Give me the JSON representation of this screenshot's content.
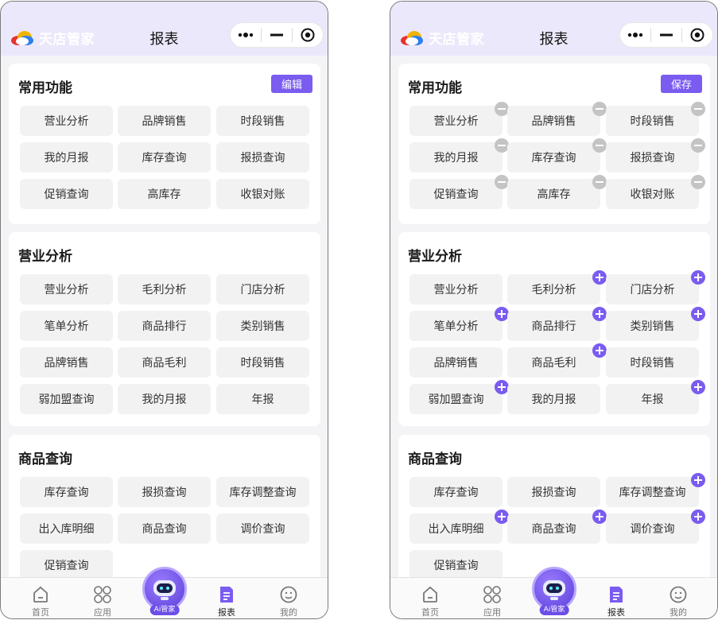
{
  "screens": [
    {
      "id": "view",
      "app_name": "天店管家",
      "page_title": "报表",
      "sections": [
        {
          "title": "常用功能",
          "action": "编辑",
          "items": [
            {
              "label": "营业分析"
            },
            {
              "label": "品牌销售"
            },
            {
              "label": "时段销售"
            },
            {
              "label": "我的月报"
            },
            {
              "label": "库存查询"
            },
            {
              "label": "报损查询"
            },
            {
              "label": "促销查询"
            },
            {
              "label": "高库存"
            },
            {
              "label": "收银对账"
            }
          ]
        },
        {
          "title": "营业分析",
          "items": [
            {
              "label": "营业分析"
            },
            {
              "label": "毛利分析"
            },
            {
              "label": "门店分析"
            },
            {
              "label": "笔单分析"
            },
            {
              "label": "商品排行"
            },
            {
              "label": "类别销售"
            },
            {
              "label": "品牌销售"
            },
            {
              "label": "商品毛利"
            },
            {
              "label": "时段销售"
            },
            {
              "label": "弱加盟查询"
            },
            {
              "label": "我的月报"
            },
            {
              "label": "年报"
            }
          ]
        },
        {
          "title": "商品查询",
          "items": [
            {
              "label": "库存查询"
            },
            {
              "label": "报损查询"
            },
            {
              "label": "库存调整查询"
            },
            {
              "label": "出入库明细"
            },
            {
              "label": "商品查询"
            },
            {
              "label": "调价查询"
            },
            {
              "label": "促销查询"
            }
          ]
        }
      ]
    },
    {
      "id": "edit",
      "app_name": "天店管家",
      "page_title": "报表",
      "sections": [
        {
          "title": "常用功能",
          "action": "保存",
          "items": [
            {
              "label": "营业分析",
              "badge": "minus"
            },
            {
              "label": "品牌销售",
              "badge": "minus"
            },
            {
              "label": "时段销售",
              "badge": "minus"
            },
            {
              "label": "我的月报",
              "badge": "minus"
            },
            {
              "label": "库存查询",
              "badge": "minus"
            },
            {
              "label": "报损查询",
              "badge": "minus"
            },
            {
              "label": "促销查询",
              "badge": "minus"
            },
            {
              "label": "高库存",
              "badge": "minus"
            },
            {
              "label": "收银对账",
              "badge": "minus"
            }
          ]
        },
        {
          "title": "营业分析",
          "items": [
            {
              "label": "营业分析"
            },
            {
              "label": "毛利分析",
              "badge": "plus"
            },
            {
              "label": "门店分析",
              "badge": "plus"
            },
            {
              "label": "笔单分析",
              "badge": "plus"
            },
            {
              "label": "商品排行",
              "badge": "plus"
            },
            {
              "label": "类别销售",
              "badge": "plus"
            },
            {
              "label": "品牌销售"
            },
            {
              "label": "商品毛利",
              "badge": "plus"
            },
            {
              "label": "时段销售"
            },
            {
              "label": "弱加盟查询",
              "badge": "plus"
            },
            {
              "label": "我的月报"
            },
            {
              "label": "年报",
              "badge": "plus"
            }
          ]
        },
        {
          "title": "商品查询",
          "items": [
            {
              "label": "库存查询"
            },
            {
              "label": "报损查询"
            },
            {
              "label": "库存调整查询",
              "badge": "plus"
            },
            {
              "label": "出入库明细",
              "badge": "plus"
            },
            {
              "label": "商品查询",
              "badge": "plus"
            },
            {
              "label": "调价查询",
              "badge": "plus"
            },
            {
              "label": "促销查询"
            }
          ]
        }
      ]
    }
  ],
  "tabbar": {
    "home": "首页",
    "apps": "应用",
    "ai": "Ai管家",
    "reports": "报表",
    "mine": "我的"
  },
  "colors": {
    "accent": "#7a5cf0",
    "header_bg": "#ece8fb",
    "page_bg": "#f4f4f6",
    "item_bg": "#f2f2f2",
    "minus_badge": "#c4c4c4"
  },
  "icons": {
    "menu": "more-dots-icon",
    "minimize": "minimize-icon",
    "close": "target-icon"
  }
}
